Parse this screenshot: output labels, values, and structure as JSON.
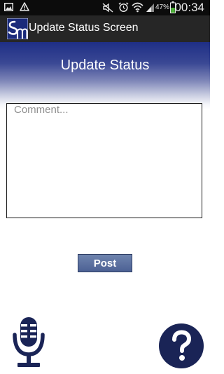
{
  "status_bar": {
    "battery_percent": "47%",
    "time": "00:34",
    "icons": [
      "image-icon",
      "warning-icon",
      "mute-icon",
      "alarm-icon",
      "wifi-icon",
      "signal-icon",
      "battery-icon"
    ]
  },
  "action_bar": {
    "logo_text": "Sm",
    "title": "Update Status Screen"
  },
  "main": {
    "title": "Update Status",
    "comment_placeholder": "Comment...",
    "comment_value": "",
    "post_label": "Post"
  },
  "icons": {
    "microphone": "microphone-icon",
    "help": "question-mark-icon"
  },
  "colors": {
    "accent": "#1f2f86",
    "icon": "#1a2456",
    "button": "#5a6fa0"
  }
}
